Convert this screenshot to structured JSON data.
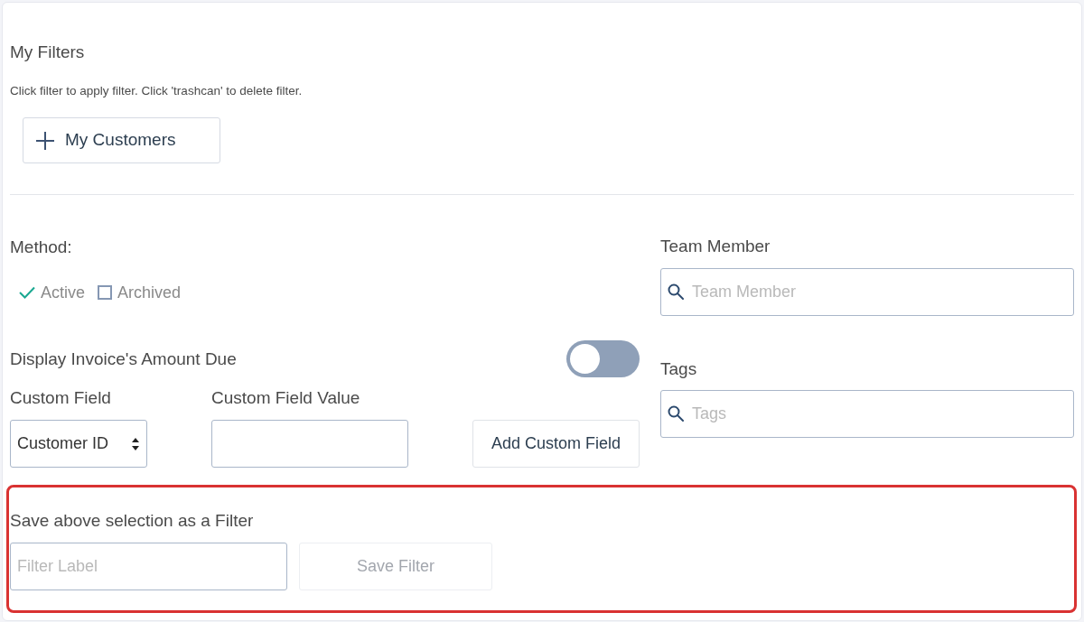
{
  "my_filters": {
    "title": "My Filters",
    "hint": "Click filter to apply filter. Click 'trashcan' to delete filter.",
    "filters": [
      {
        "label": "My Customers"
      }
    ]
  },
  "method": {
    "label": "Method:",
    "options": [
      {
        "label": "Active",
        "checked": true
      },
      {
        "label": "Archived",
        "checked": false
      }
    ]
  },
  "amount_due": {
    "label": "Display Invoice's Amount Due",
    "on": false
  },
  "custom_field": {
    "label": "Custom Field",
    "value": "Customer ID"
  },
  "custom_field_value": {
    "label": "Custom Field Value"
  },
  "add_custom_field": {
    "label": "Add Custom Field"
  },
  "team_member": {
    "label": "Team Member",
    "placeholder": "Team Member"
  },
  "tags": {
    "label": "Tags",
    "placeholder": "Tags"
  },
  "save_filter": {
    "highlighted": true,
    "label": "Save above selection as a Filter",
    "placeholder": "Filter Label",
    "button": {
      "label": "Save Filter",
      "disabled": true
    }
  }
}
